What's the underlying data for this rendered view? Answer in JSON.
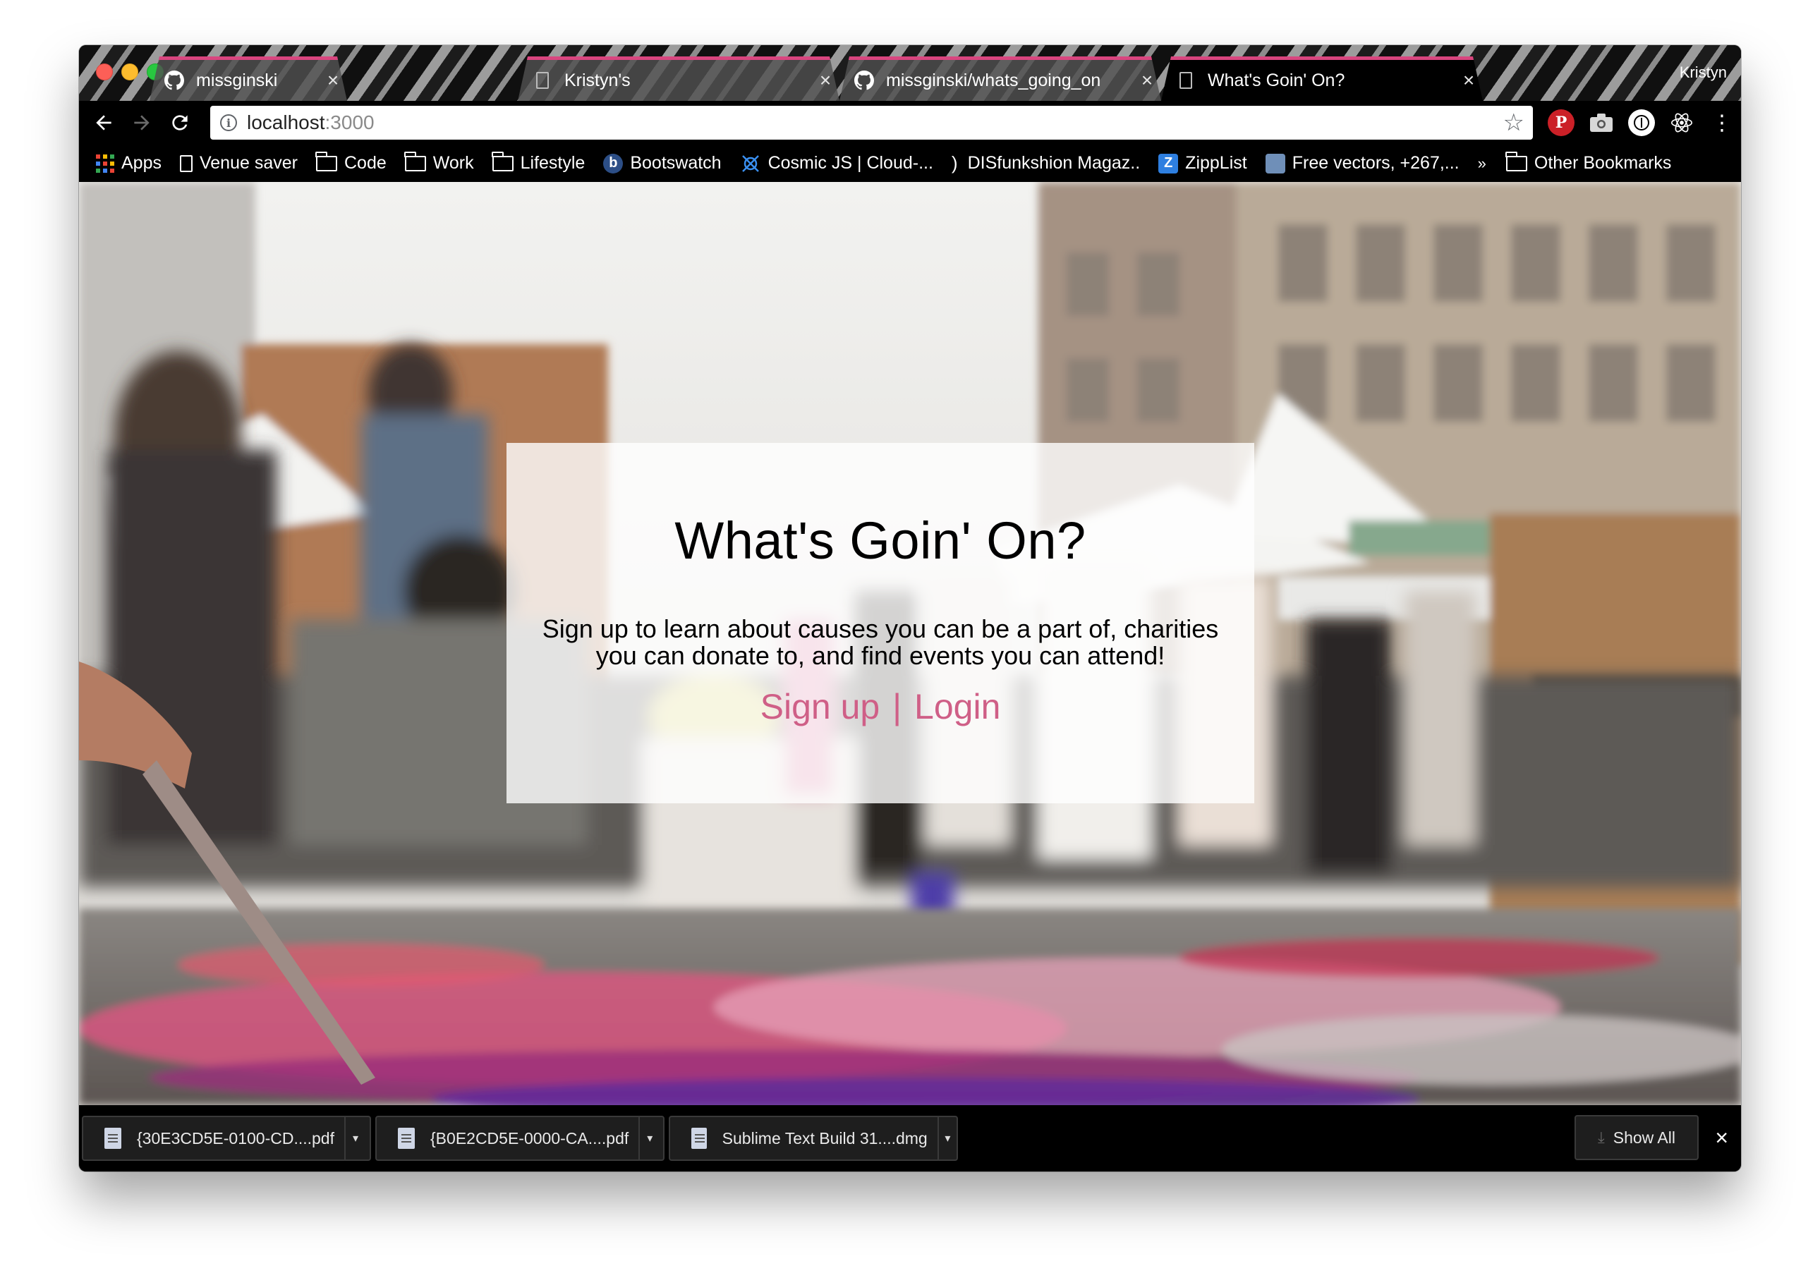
{
  "browser": {
    "profile_name": "Kristyn",
    "tabs": [
      {
        "title": "missginski",
        "icon": "github-icon",
        "active": false
      },
      {
        "title": "Kristyn's",
        "icon": "page-icon",
        "active": false
      },
      {
        "title": "missginski/whats_going_on",
        "icon": "github-icon",
        "active": false
      },
      {
        "title": "What's Goin' On?",
        "icon": "page-icon",
        "active": true
      }
    ],
    "tab_close_glyph": "×",
    "address": {
      "host": "localhost",
      "port": ":3000"
    },
    "bookmarks": [
      {
        "label": "Apps",
        "icon": "apps-grid-icon"
      },
      {
        "label": "Venue saver",
        "icon": "page-icon"
      },
      {
        "label": "Code",
        "icon": "folder-icon"
      },
      {
        "label": "Work",
        "icon": "folder-icon"
      },
      {
        "label": "Lifestyle",
        "icon": "folder-icon"
      },
      {
        "label": "Bootswatch",
        "icon": "bootswatch-icon"
      },
      {
        "label": "Cosmic JS | Cloud-...",
        "icon": "cosmic-js-icon"
      },
      {
        "label": "DISfunkshion Magaz..",
        "icon": "disfunkshion-icon"
      },
      {
        "label": "ZippList",
        "icon": "ziplist-icon"
      },
      {
        "label": "Free vectors, +267,...",
        "icon": "free-vectors-icon"
      }
    ],
    "bookmarks_overflow": "»",
    "other_bookmarks": "Other Bookmarks",
    "accent_color": "#d9457f"
  },
  "page": {
    "title": "What's Goin' On?",
    "description": "Sign up to learn about causes you can be a part of, charities you can donate to, and find events you can attend!",
    "signup_link": "Sign up",
    "separator": "|",
    "login_link": "Login",
    "link_color": "#cf5f87"
  },
  "downloads": {
    "items": [
      {
        "name": "{30E3CD5E-0100-CD....pdf"
      },
      {
        "name": "{B0E2CD5E-0000-CA....pdf"
      },
      {
        "name": "Sublime Text Build 31....dmg"
      }
    ],
    "menu_glyph": "▾",
    "show_all": "Show All",
    "close_glyph": "×"
  }
}
